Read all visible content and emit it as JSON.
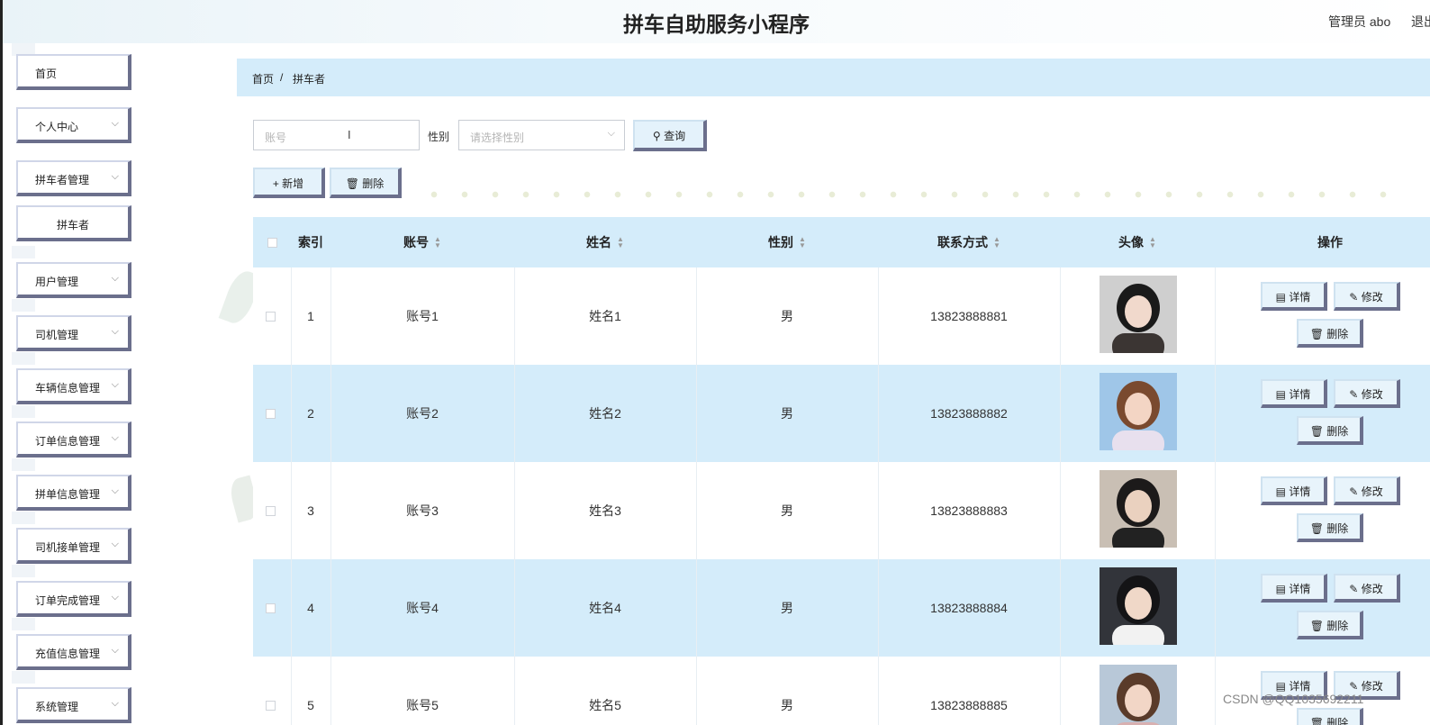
{
  "header": {
    "title": "拼车自助服务小程序",
    "user": "管理员 abo",
    "logout": "退出"
  },
  "sidebar": {
    "items": [
      {
        "label": "首页",
        "chevron": false,
        "sub": false
      },
      {
        "label": "个人中心",
        "chevron": true,
        "sub": false
      },
      {
        "label": "拼车者管理",
        "chevron": true,
        "sub": false
      },
      {
        "label": "拼车者",
        "chevron": false,
        "sub": true
      },
      {
        "label": "用户管理",
        "chevron": true,
        "sub": false
      },
      {
        "label": "司机管理",
        "chevron": true,
        "sub": false
      },
      {
        "label": "车辆信息管理",
        "chevron": true,
        "sub": false
      },
      {
        "label": "订单信息管理",
        "chevron": true,
        "sub": false
      },
      {
        "label": "拼单信息管理",
        "chevron": true,
        "sub": false
      },
      {
        "label": "司机接单管理",
        "chevron": true,
        "sub": false
      },
      {
        "label": "订单完成管理",
        "chevron": true,
        "sub": false
      },
      {
        "label": "充值信息管理",
        "chevron": true,
        "sub": false
      },
      {
        "label": "系统管理",
        "chevron": true,
        "sub": false
      }
    ]
  },
  "breadcrumb": {
    "home": "首页",
    "sep": "/",
    "current": "拼车者"
  },
  "search": {
    "account_placeholder": "账号",
    "gender_label": "性别",
    "gender_placeholder": "请选择性别",
    "query_label": "查询"
  },
  "toolbar": {
    "add_label": "新增",
    "delete_label": "删除"
  },
  "table": {
    "headers": {
      "index": "索引",
      "account": "账号",
      "name": "姓名",
      "gender": "性别",
      "contact": "联系方式",
      "avatar": "头像",
      "actions": "操作"
    },
    "actions": {
      "detail": "详情",
      "edit": "修改",
      "delete": "删除"
    },
    "rows": [
      {
        "index": "1",
        "account": "账号1",
        "name": "姓名1",
        "gender": "男",
        "contact": "13823888881"
      },
      {
        "index": "2",
        "account": "账号2",
        "name": "姓名2",
        "gender": "男",
        "contact": "13823888882"
      },
      {
        "index": "3",
        "account": "账号3",
        "name": "姓名3",
        "gender": "男",
        "contact": "13823888883"
      },
      {
        "index": "4",
        "account": "账号4",
        "name": "姓名4",
        "gender": "男",
        "contact": "13823888884"
      },
      {
        "index": "5",
        "account": "账号5",
        "name": "姓名5",
        "gender": "男",
        "contact": "13823888885"
      }
    ]
  },
  "watermark": "CSDN @QQ1035692211",
  "colors": {
    "accent_light": "#d4ecfa",
    "button_border": "#6b6f8c"
  }
}
